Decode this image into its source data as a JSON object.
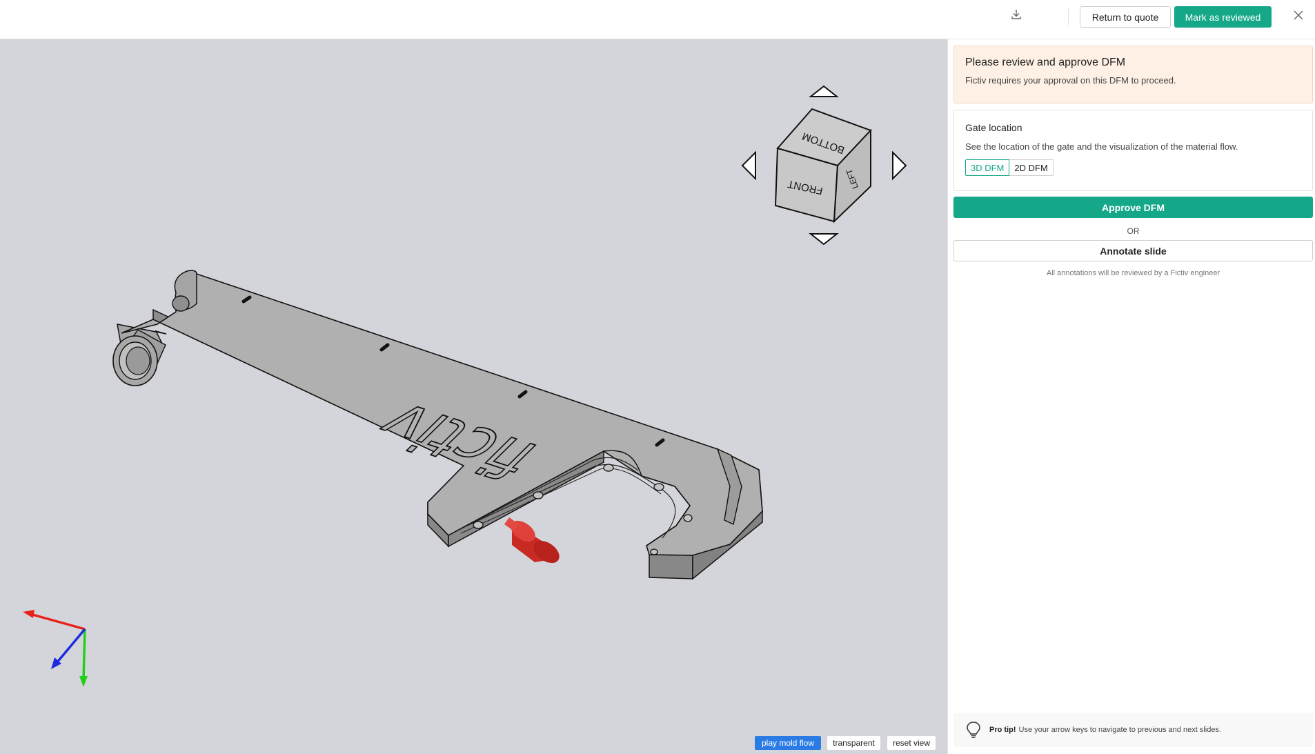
{
  "topbar": {
    "download_icon": "download-icon",
    "return_label": "Return to quote",
    "reviewed_label": "Mark as reviewed",
    "close_icon": "close-icon"
  },
  "viewer": {
    "part_logo_text": "fictiv",
    "view_cube": {
      "faces": {
        "front": "FRONT",
        "bottom": "BOTTOM",
        "left": "LEFT"
      },
      "nav_icons": [
        "arrow-up-icon",
        "arrow-down-icon",
        "arrow-left-icon",
        "arrow-right-icon"
      ]
    },
    "axis_colors": {
      "x": "#e8211d",
      "y": "#22d01b",
      "z": "#1d2be0"
    },
    "gate_color": "#d92b25",
    "controls": {
      "play_label": "play mold flow",
      "transparent_label": "transparent",
      "reset_label": "reset view"
    }
  },
  "panel": {
    "review": {
      "title": "Please review and approve DFM",
      "text": "Fictiv requires your approval on this DFM to proceed."
    },
    "gate": {
      "title": "Gate location",
      "text": "See the location of the gate and the visualization of the material flow.",
      "tabs": [
        "3D DFM",
        "2D DFM"
      ],
      "active_tab": "3D DFM"
    },
    "approve_label": "Approve DFM",
    "or_label": "OR",
    "annotate_label": "Annotate slide",
    "annotate_note": "All annotations will be reviewed by a Fictiv engineer",
    "tip": {
      "icon": "lightbulb-icon",
      "strong": "Pro tip!",
      "text": "Use your arrow keys to navigate to previous and next slides."
    }
  },
  "colors": {
    "accent": "#14a889",
    "viewer_bg": "#d4d5da",
    "review_bg": "#fef0e4",
    "play_button": "#2a7be4"
  }
}
